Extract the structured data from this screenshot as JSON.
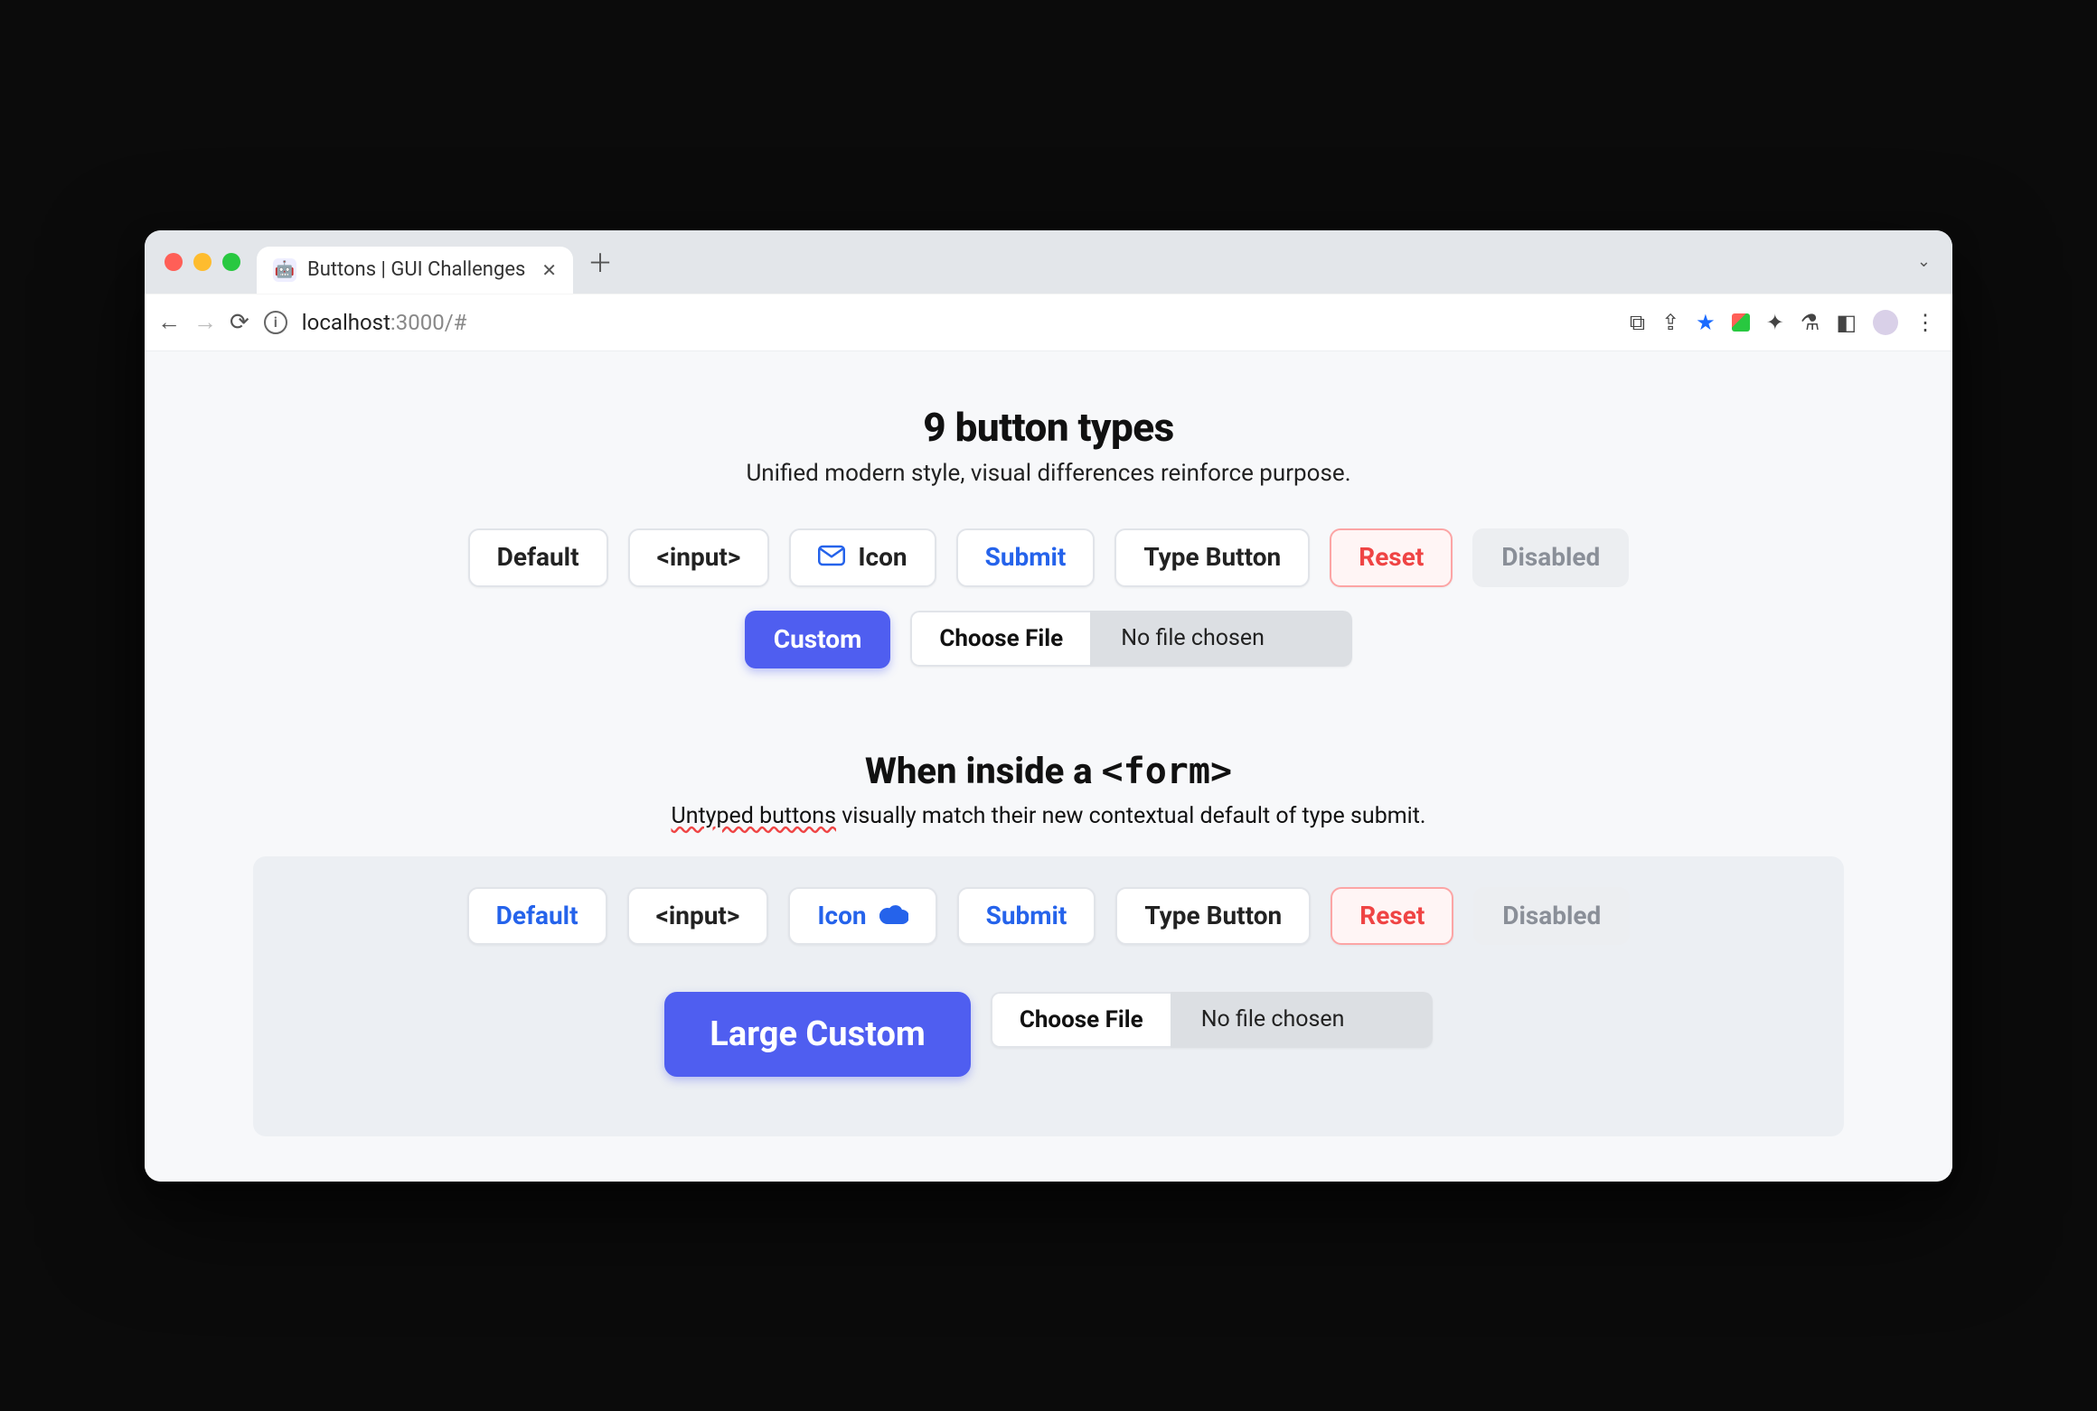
{
  "browser": {
    "tab_title": "Buttons | GUI Challenges",
    "url_host": "localhost",
    "url_port_path": ":3000/#"
  },
  "section1": {
    "title": "9 button types",
    "subtitle": "Unified modern style, visual differences reinforce purpose.",
    "buttons": {
      "default": "Default",
      "input": "<input>",
      "icon": "Icon",
      "submit": "Submit",
      "type_button": "Type Button",
      "reset": "Reset",
      "disabled": "Disabled",
      "custom": "Custom"
    },
    "file": {
      "choose_label": "Choose File",
      "status": "No file chosen"
    }
  },
  "section2": {
    "title_prefix": "When inside a ",
    "title_code": "<form>",
    "subtitle_underlined": "Untyped buttons",
    "subtitle_rest": " visually match their new contextual default of type submit.",
    "buttons": {
      "default": "Default",
      "input": "<input>",
      "icon": "Icon",
      "submit": "Submit",
      "type_button": "Type Button",
      "reset": "Reset",
      "disabled": "Disabled",
      "large_custom": "Large Custom"
    },
    "file": {
      "choose_label": "Choose File",
      "status": "No file chosen"
    }
  }
}
